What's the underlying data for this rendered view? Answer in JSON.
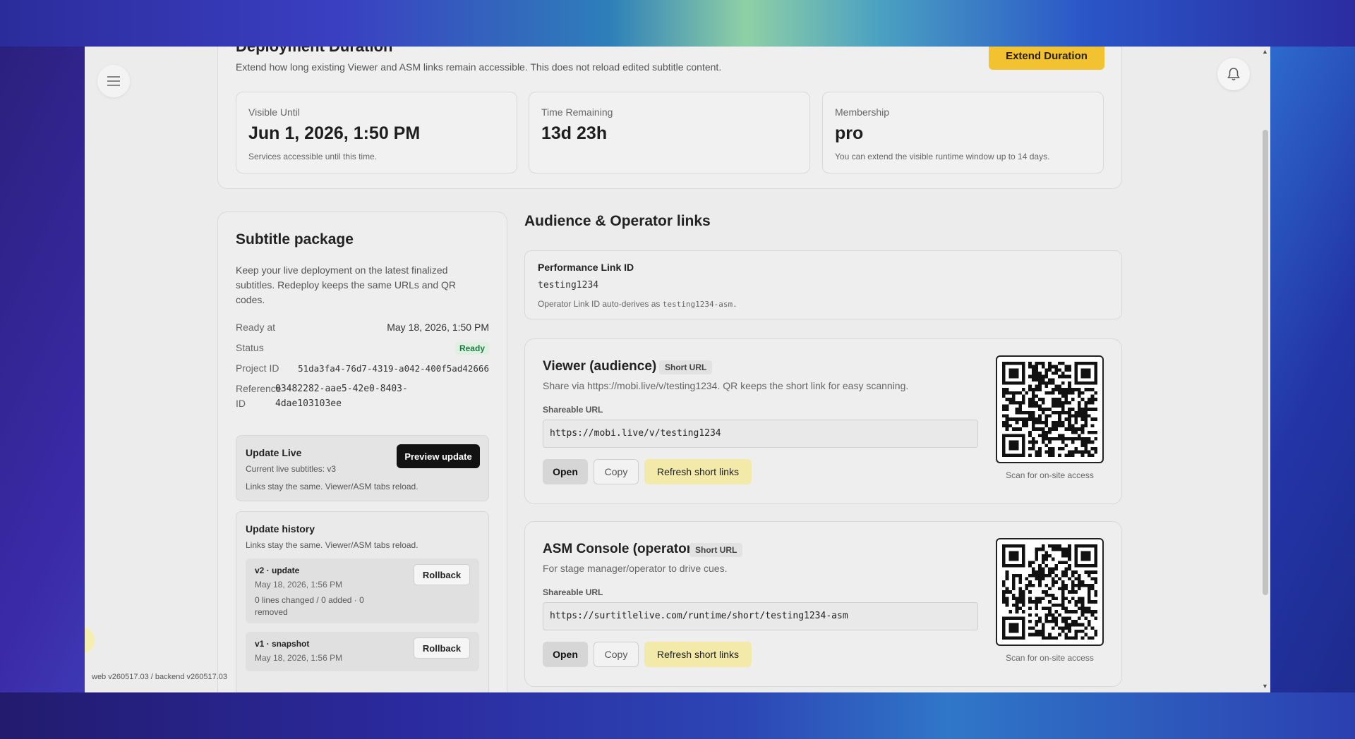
{
  "deployment": {
    "title": "Deployment Duration",
    "subtitle": "Extend how long existing Viewer and ASM links remain accessible. This does not reload edited subtitle content.",
    "extend_label": "Extend Duration",
    "stats": [
      {
        "label": "Visible Until",
        "value": "Jun 1, 2026, 1:50 PM",
        "note": "Services accessible until this time."
      },
      {
        "label": "Time Remaining",
        "value": "13d 23h",
        "note": ""
      },
      {
        "label": "Membership",
        "value": "pro",
        "note": "You can extend the visible runtime window up to 14 days."
      }
    ]
  },
  "subtitle_package": {
    "title": "Subtitle package",
    "description": "Keep your live deployment on the latest finalized subtitles. Redeploy keeps the same URLs and QR codes.",
    "ready_at_label": "Ready at",
    "ready_at_value": "May 18, 2026, 1:50 PM",
    "status_label": "Status",
    "status_value": "Ready",
    "project_id_label": "Project ID",
    "project_id_value": "51da3fa4-76d7-4319-a042-400f5ad42666",
    "reference_label_1": "Reference",
    "reference_label_2": "ID",
    "reference_value_1": "03482282-aae5-42e0-8403-",
    "reference_value_2": "4dae103103ee",
    "update_live": {
      "title": "Update Live",
      "current": "Current live subtitles: v3",
      "note": "Links stay the same. Viewer/ASM tabs reload.",
      "preview_label": "Preview update"
    },
    "history": {
      "title": "Update history",
      "note": "Links stay the same. Viewer/ASM tabs reload.",
      "items": [
        {
          "name": "v2 · update",
          "date": "May 18, 2026, 1:56 PM",
          "changes": "0 lines changed / 0 added · 0 removed",
          "action": "Rollback"
        },
        {
          "name": "v1 · snapshot",
          "date": "May 18, 2026, 1:56 PM",
          "changes": "",
          "action": "Rollback"
        }
      ]
    }
  },
  "links": {
    "title": "Audience & Operator links",
    "performance": {
      "label": "Performance Link ID",
      "value": "testing1234",
      "note_prefix": "Operator Link ID auto-derives as",
      "note_value": "testing1234-asm."
    },
    "viewer": {
      "title": "Viewer (audience)",
      "badge": "Short URL",
      "description": "Share via https://mobi.live/v/testing1234. QR keeps the short link for easy scanning.",
      "url_label": "Shareable URL",
      "url": "https://mobi.live/v/testing1234",
      "open_label": "Open",
      "copy_label": "Copy",
      "refresh_label": "Refresh short links",
      "qr_caption": "Scan for on-site access"
    },
    "asm": {
      "title": "ASM Console (operator)",
      "badge": "Short URL",
      "description": "For stage manager/operator to drive cues.",
      "url_label": "Shareable URL",
      "url": "https://surtitlelive.com/runtime/short/testing1234-asm",
      "open_label": "Open",
      "copy_label": "Copy",
      "refresh_label": "Refresh short links",
      "qr_caption": "Scan for on-site access"
    }
  },
  "footer": {
    "version": "web v260517.03 / backend v260517.03"
  },
  "icons": {
    "menu": "hamburger-menu-icon",
    "bell": "bell-icon",
    "qr": "qr-code-icon"
  },
  "colors": {
    "accent_yellow": "#f2c230",
    "refresh_yellow": "#f3e9a8",
    "ready_green": "#1c7c3b",
    "dark_button": "#121212"
  }
}
